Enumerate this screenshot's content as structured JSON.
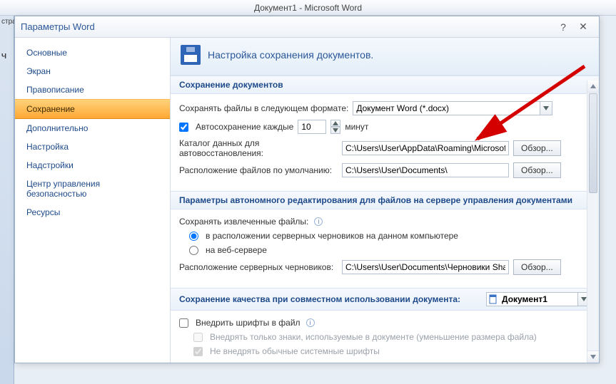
{
  "app_title": "Документ1 - Microsoft Word",
  "dialog_title": "Параметры Word",
  "sidebar": {
    "items": [
      "Основные",
      "Экран",
      "Правописание",
      "Сохранение",
      "Дополнительно",
      "Настройка",
      "Надстройки",
      "Центр управления безопасностью",
      "Ресурсы"
    ],
    "selected_index": 3
  },
  "header_text": "Настройка сохранения документов.",
  "section1": {
    "title": "Сохранение документов",
    "format_label": "Сохранять файлы в следующем формате:",
    "format_value": "Документ Word (*.docx)",
    "autosave_label": "Автосохранение каждые",
    "autosave_value": "10",
    "autosave_unit": "минут",
    "autorecover_label": "Каталог данных для автовосстановления:",
    "autorecover_path": "C:\\Users\\User\\AppData\\Roaming\\Microsoft\\W",
    "default_loc_label": "Расположение файлов по умолчанию:",
    "default_loc_path": "C:\\Users\\User\\Documents\\",
    "browse": "Обзор..."
  },
  "section2": {
    "title": "Параметры автономного редактирования для файлов на сервере управления документами",
    "save_checked_label": "Сохранять извлеченные файлы:",
    "radio1": "в расположении серверных черновиков на данном компьютере",
    "radio2": "на веб-сервере",
    "drafts_label": "Расположение серверных черновиков:",
    "drafts_path": "C:\\Users\\User\\Documents\\Черновики SharePo",
    "browse": "Обзор..."
  },
  "section3": {
    "title": "Сохранение качества при совместном использовании документа:",
    "doc_name": "Документ1",
    "embed_fonts": "Внедрить шрифты в файл",
    "embed_used_only": "Внедрять только знаки, используемые в документе (уменьшение размера файла)",
    "no_system_fonts": "Не внедрять обычные системные шрифты"
  }
}
